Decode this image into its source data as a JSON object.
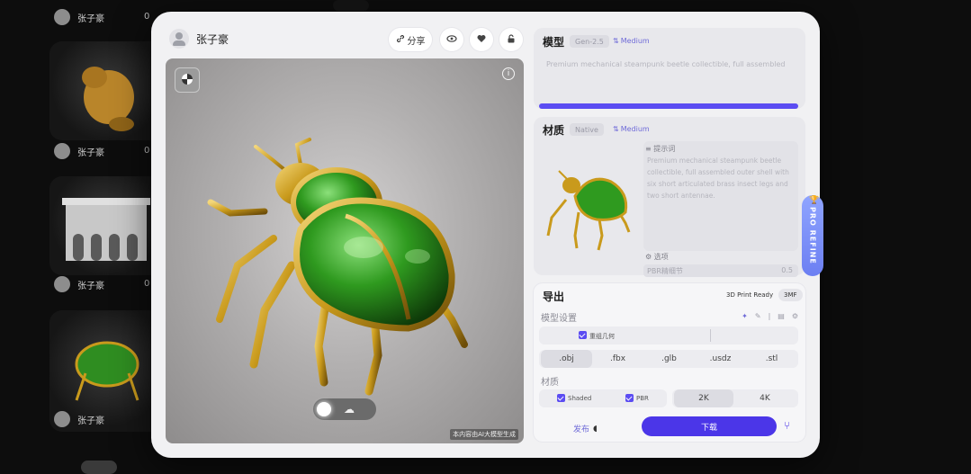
{
  "background": {
    "username": "张子豪",
    "count_prefix": "0"
  },
  "header": {
    "user_name": "张子豪",
    "share_label": "分享"
  },
  "viewer": {
    "watermark": "本内容由AI大模型生成"
  },
  "model_panel": {
    "title": "模型",
    "version_tag": "Gen-2.5",
    "quality": "Medium",
    "prompt": "Premium mechanical steampunk beetle collectible, full assembled"
  },
  "material_panel": {
    "title": "材质",
    "tag": "Native",
    "quality": "Medium",
    "prompt_label": "提示词",
    "prompt": "Premium mechanical steampunk beetle collectible, full assembled outer shell with six short articulated brass insect legs and two short antennae.",
    "options_label": "选项",
    "pbr_label": "PBR精细节",
    "pbr_value": "0.5"
  },
  "pro_refine": {
    "label": "PRO REFINE"
  },
  "export_panel": {
    "title": "导出",
    "print_ready": "3D Print Ready",
    "format_badge": "3MF",
    "model_settings_label": "模型设置",
    "merge_label": "重组几何",
    "formats": [
      ".obj",
      ".fbx",
      ".glb",
      ".usdz",
      ".stl"
    ],
    "selected_format": ".obj",
    "material_label": "材质",
    "shaded_label": "Shaded",
    "pbr_label": "PBR",
    "resolutions": [
      "2K",
      "4K"
    ],
    "selected_resolution": "2K",
    "publish_label": "发布",
    "download_label": "下载"
  },
  "colors": {
    "accent": "#4b36e8",
    "modal_bg": "#f1f1f3",
    "beetle_green": "#2f9a1f",
    "beetle_gold": "#c99a1c"
  }
}
